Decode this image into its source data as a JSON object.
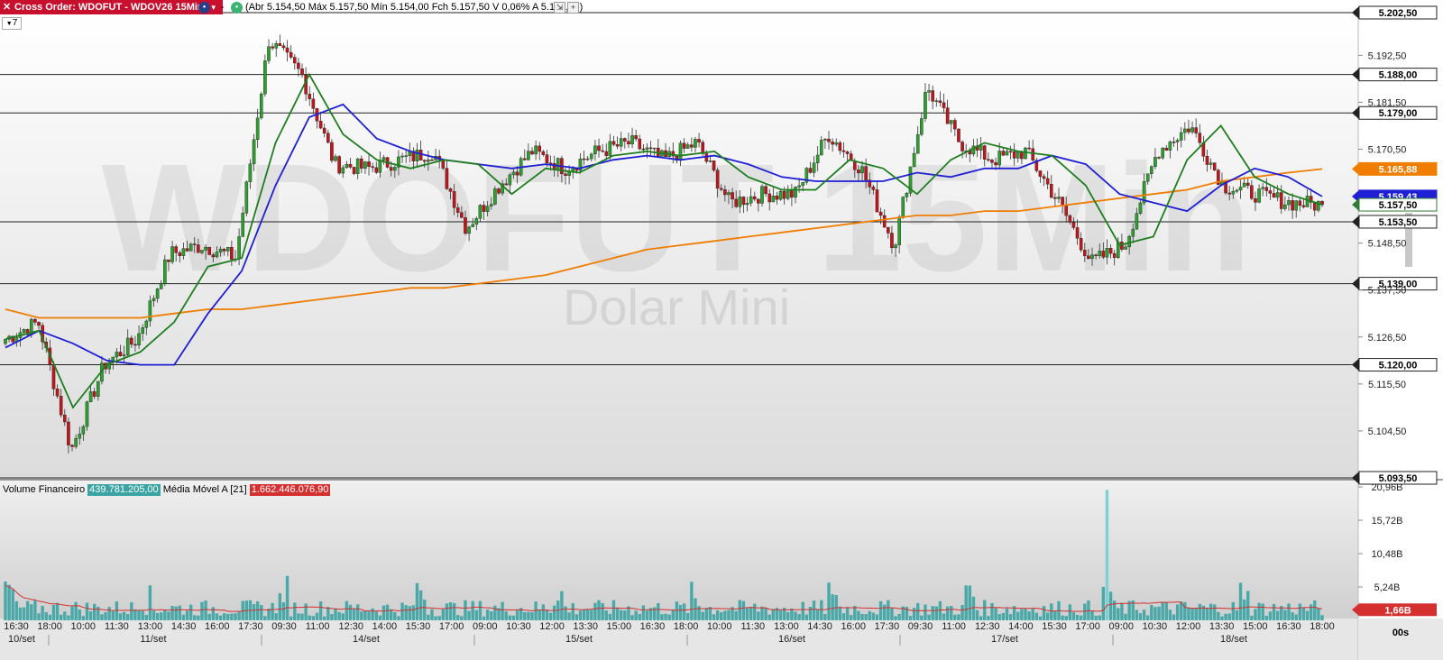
{
  "header": {
    "title": "Cross Order: WDOFUT - WDOV26 15Min",
    "ohlc_text": "(Abr 5.154,50 Máx 5.157,50 Mín 5.154,00 Fch 5.157,50 V 0,06% A 5.159,18)",
    "period": "7"
  },
  "watermark": {
    "symbol": "WDOFUT 15Min",
    "name": "Dolar Mini"
  },
  "price_axis": {
    "ticks": [
      "5.192,50",
      "5.181,50",
      "5.170,50",
      "5.159,50",
      "5.148,50",
      "5.137,50",
      "5.126,50",
      "5.115,50",
      "5.104,50"
    ],
    "hlines": [
      {
        "label": "5.202,50",
        "value": 5202.5
      },
      {
        "label": "5.188,00",
        "value": 5188.0
      },
      {
        "label": "5.179,00",
        "value": 5179.0
      },
      {
        "label": "5.153,50",
        "value": 5153.5
      },
      {
        "label": "5.139,00",
        "value": 5139.0
      },
      {
        "label": "5.120,00",
        "value": 5120.0
      },
      {
        "label": "5.093,50",
        "value": 5093.5
      }
    ],
    "badges": [
      {
        "label": "5.165,88",
        "value": 5165.88,
        "color": "#f07d00"
      },
      {
        "label": "5.159,43",
        "value": 5159.43,
        "color": "#1f1fd6"
      },
      {
        "label": "5.157,50",
        "value": 5157.5,
        "color": "#2e7d32"
      }
    ]
  },
  "volume": {
    "title": "Volume Financeiro",
    "value": "439.781.205,00",
    "ma_label": "Média Móvel A [21]",
    "ma_value": "1.662.446.076,90",
    "ticks": [
      "20,96B",
      "15,72B",
      "10,48B",
      "5,24B"
    ],
    "current_badge": "1,66B"
  },
  "time_axis": {
    "labels": [
      "16:30",
      "18:00",
      "10:00",
      "11:30",
      "13:00",
      "14:30",
      "16:00",
      "17:30",
      "09:30",
      "11:00",
      "12:30",
      "14:00",
      "15:30",
      "17:00",
      "09:00",
      "10:30",
      "12:00",
      "13:30",
      "15:00",
      "16:30",
      "18:00",
      "10:00",
      "11:30",
      "13:00",
      "14:30",
      "16:00",
      "17:30",
      "09:30",
      "11:00",
      "12:30",
      "14:00",
      "15:30",
      "17:00",
      "09:00",
      "10:30",
      "12:00",
      "13:30",
      "15:00",
      "16:30",
      "18:00"
    ],
    "dates": [
      "10/set",
      "11/set",
      "14/set",
      "15/set",
      "16/set",
      "17/set",
      "18/set"
    ],
    "countdown": "00s"
  },
  "colors": {
    "up": "#2ca02c",
    "down": "#c0151b",
    "ma_green": "#1e7d1e",
    "ma_blue": "#1f1fd6",
    "ma_orange": "#f07d00",
    "volume_bar": "#4aa8a8",
    "volume_ma": "#d43030"
  },
  "chart_data": {
    "type": "candlestick",
    "price_range": [
      5093.5,
      5202.5
    ],
    "last_close": 5157.5,
    "volume_range_billions": [
      0,
      20.96
    ],
    "anchors": [
      {
        "x_label": "16:30 10/set",
        "price": 5126
      },
      {
        "x_label": "18:00 10/set",
        "price": 5130
      },
      {
        "x_label": "10:00 11/set",
        "price": 5100
      },
      {
        "x_label": "11:30 11/set",
        "price": 5120
      },
      {
        "x_label": "13:00 11/set",
        "price": 5126
      },
      {
        "x_label": "14:30 11/set",
        "price": 5146
      },
      {
        "x_label": "16:00 11/set",
        "price": 5148
      },
      {
        "x_label": "17:30 11/set",
        "price": 5145
      },
      {
        "x_label": "09:30 14/set",
        "price": 5196
      },
      {
        "x_label": "11:00 14/set",
        "price": 5188
      },
      {
        "x_label": "12:30 14/set",
        "price": 5167
      },
      {
        "x_label": "14:00 14/set",
        "price": 5166
      },
      {
        "x_label": "15:30 14/set",
        "price": 5168
      },
      {
        "x_label": "17:00 14/set",
        "price": 5170
      },
      {
        "x_label": "09:00 15/set",
        "price": 5152
      },
      {
        "x_label": "10:30 15/set",
        "price": 5162
      },
      {
        "x_label": "12:00 15/set",
        "price": 5170
      },
      {
        "x_label": "13:30 15/set",
        "price": 5166
      },
      {
        "x_label": "15:00 15/set",
        "price": 5170
      },
      {
        "x_label": "16:30 15/set",
        "price": 5172
      },
      {
        "x_label": "18:00 15/set",
        "price": 5168
      },
      {
        "x_label": "10:00 16/set",
        "price": 5172
      },
      {
        "x_label": "11:30 16/set",
        "price": 5158
      },
      {
        "x_label": "13:00 16/set",
        "price": 5160
      },
      {
        "x_label": "14:30 16/set",
        "price": 5160
      },
      {
        "x_label": "16:00 16/set",
        "price": 5174
      },
      {
        "x_label": "17:30 16/set",
        "price": 5166
      },
      {
        "x_label": "09:30 17/set",
        "price": 5148
      },
      {
        "x_label": "10:00 17/set",
        "price": 5185
      },
      {
        "x_label": "11:00 17/set",
        "price": 5172
      },
      {
        "x_label": "12:30 17/set",
        "price": 5168
      },
      {
        "x_label": "14:00 17/set",
        "price": 5170
      },
      {
        "x_label": "15:30 17/set",
        "price": 5158
      },
      {
        "x_label": "17:00 17/set",
        "price": 5144
      },
      {
        "x_label": "09:00 18/set",
        "price": 5148
      },
      {
        "x_label": "10:30 18/set",
        "price": 5170
      },
      {
        "x_label": "12:00 18/set",
        "price": 5176
      },
      {
        "x_label": "13:30 18/set",
        "price": 5162
      },
      {
        "x_label": "15:00 18/set",
        "price": 5160
      },
      {
        "x_label": "16:30 18/set",
        "price": 5158
      },
      {
        "x_label": "18:00 18/set",
        "price": 5157.5
      }
    ],
    "ma_orange": [
      5133,
      5131,
      5131,
      5131,
      5131,
      5132,
      5133,
      5133,
      5134,
      5135,
      5136,
      5137,
      5138,
      5138,
      5139,
      5140,
      5141,
      5143,
      5145,
      5147,
      5148,
      5149,
      5150,
      5151,
      5152,
      5153,
      5154,
      5155,
      5155,
      5156,
      5156,
      5157,
      5158,
      5159,
      5160,
      5161,
      5163,
      5164,
      5165,
      5165.88
    ],
    "ma_blue": [
      5124,
      5128,
      5125,
      5121,
      5120,
      5120,
      5132,
      5142,
      5162,
      5178,
      5181,
      5173,
      5170,
      5168,
      5167,
      5166,
      5167,
      5166,
      5168,
      5169,
      5168,
      5169,
      5167,
      5164,
      5163,
      5163,
      5163,
      5165,
      5164,
      5166,
      5166,
      5169,
      5167,
      5160,
      5158,
      5156,
      5162,
      5166,
      5164,
      5159.43
    ],
    "ma_green": [
      5126,
      5128,
      5110,
      5120,
      5123,
      5130,
      5143,
      5145,
      5172,
      5188,
      5174,
      5168,
      5166,
      5168,
      5167,
      5160,
      5166,
      5165,
      5169,
      5170,
      5169,
      5170,
      5164,
      5161,
      5161,
      5168,
      5166,
      5160,
      5168,
      5172,
      5170,
      5169,
      5162,
      5148,
      5150,
      5168,
      5176,
      5164,
      5160,
      5157.5
    ]
  }
}
